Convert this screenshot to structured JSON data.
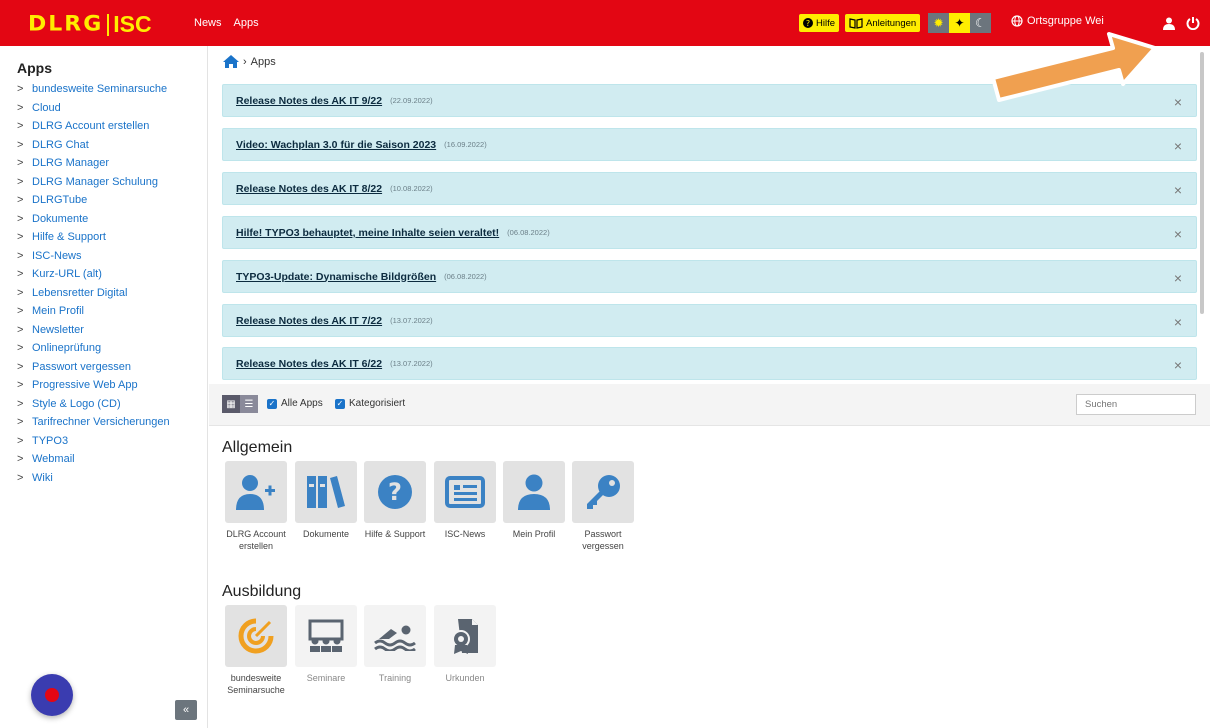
{
  "header": {
    "brand_dlrg": "DLRG",
    "brand_isc": "ISC",
    "nav": [
      "News",
      "Apps"
    ],
    "help_label": "Hilfe",
    "guides_label": "Anleitungen",
    "org_label": "Ortsgruppe Wei",
    "accent_color": "#e30613",
    "brand_color": "#ffed00"
  },
  "sidebar": {
    "title": "Apps",
    "items": [
      "bundesweite Seminarsuche",
      "Cloud",
      "DLRG Account erstellen",
      "DLRG Chat",
      "DLRG Manager",
      "DLRG Manager Schulung",
      "DLRGTube",
      "Dokumente",
      "Hilfe & Support",
      "ISC-News",
      "Kurz-URL (alt)",
      "Lebensretter Digital",
      "Mein Profil",
      "Newsletter",
      "Onlineprüfung",
      "Passwort vergessen",
      "Progressive Web App",
      "Style & Logo (CD)",
      "Tarifrechner Versicherungen",
      "TYPO3",
      "Webmail",
      "Wiki"
    ],
    "collapse_label": "«"
  },
  "breadcrumb": {
    "current": "Apps"
  },
  "notices": [
    {
      "title": "Release Notes des AK IT 9/22",
      "date": "(22.09.2022)"
    },
    {
      "title": "Video: Wachplan 3.0 für die Saison 2023",
      "date": "(16.09.2022)"
    },
    {
      "title": "Release Notes des AK IT 8/22",
      "date": "(10.08.2022)"
    },
    {
      "title": "Hilfe! TYPO3 behauptet, meine Inhalte seien veraltet!",
      "date": "(06.08.2022)"
    },
    {
      "title": "TYPO3-Update: Dynamische Bildgrößen",
      "date": "(06.08.2022)"
    },
    {
      "title": "Release Notes des AK IT 7/22",
      "date": "(13.07.2022)"
    },
    {
      "title": "Release Notes des AK IT 6/22",
      "date": "(13.07.2022)"
    }
  ],
  "toolbar": {
    "all_apps_label": "Alle Apps",
    "categorized_label": "Kategorisiert",
    "search_placeholder": "Suchen"
  },
  "sections": {
    "general": {
      "title": "Allgemein",
      "apps": [
        {
          "label": "DLRG Account erstellen",
          "icon": "add-user-icon"
        },
        {
          "label": "Dokumente",
          "icon": "books-icon"
        },
        {
          "label": "Hilfe & Support",
          "icon": "question-icon"
        },
        {
          "label": "ISC-News",
          "icon": "newspaper-icon"
        },
        {
          "label": "Mein Profil",
          "icon": "user-icon"
        },
        {
          "label": "Passwort vergessen",
          "icon": "key-icon"
        }
      ]
    },
    "training": {
      "title": "Ausbildung",
      "apps": [
        {
          "label": "bundesweite Seminarsuche",
          "icon": "target-icon"
        },
        {
          "label": "Seminare",
          "icon": "seminar-icon"
        },
        {
          "label": "Training",
          "icon": "swimmer-icon"
        },
        {
          "label": "Urkunden",
          "icon": "certificate-icon"
        }
      ]
    }
  }
}
